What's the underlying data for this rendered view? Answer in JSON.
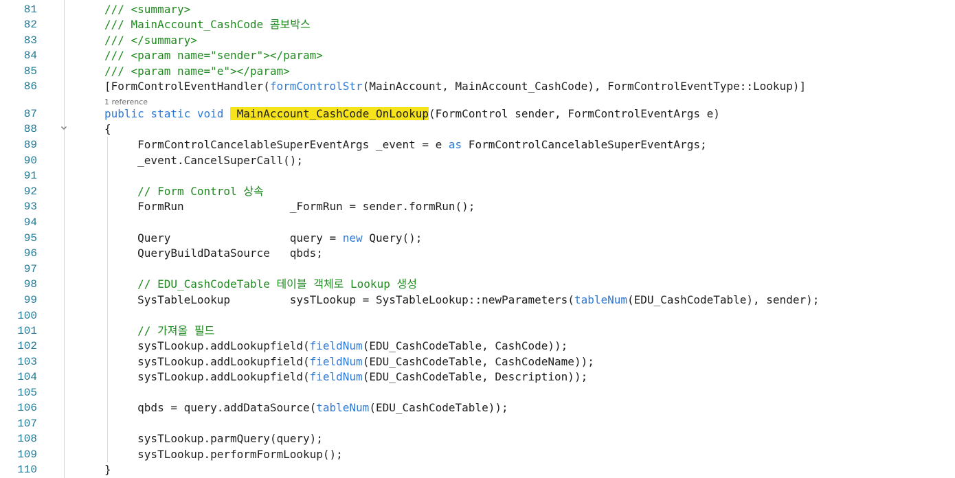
{
  "colors": {
    "comment": "#1f8a1f",
    "keyword": "#2f79d6",
    "text": "#1e1e1e",
    "line_number": "#237893",
    "highlight": "#f7e31b",
    "codelens": "#6a6a6a"
  },
  "codelens": {
    "label": "1 reference"
  },
  "fold_icon": "chevron-down-icon",
  "lines": [
    {
      "num": "81",
      "tokens": [
        {
          "t": "/// <summary>",
          "c": "comment"
        }
      ]
    },
    {
      "num": "82",
      "tokens": [
        {
          "t": "/// MainAccount_CashCode 콤보박스",
          "c": "comment"
        }
      ]
    },
    {
      "num": "83",
      "tokens": [
        {
          "t": "/// </summary>",
          "c": "comment"
        }
      ]
    },
    {
      "num": "84",
      "tokens": [
        {
          "t": "/// <param name=\"sender\"></param>",
          "c": "comment"
        }
      ]
    },
    {
      "num": "85",
      "tokens": [
        {
          "t": "/// <param name=\"e\"></param>",
          "c": "comment"
        }
      ]
    },
    {
      "num": "86",
      "tokens": [
        {
          "t": "[FormControlEventHandler(",
          "c": "text"
        },
        {
          "t": "formControlStr",
          "c": "keyword"
        },
        {
          "t": "(MainAccount, MainAccount_CashCode), FormControlEventType::Lookup)]",
          "c": "text"
        }
      ]
    },
    {
      "num": "87",
      "tokens": [
        {
          "t": "public static void",
          "c": "keyword"
        },
        {
          "t": " ",
          "c": "text"
        },
        {
          "t": " MainAccount_CashCode_OnLookup",
          "c": "highlight"
        },
        {
          "t": "(FormControl sender, FormControlEventArgs e)",
          "c": "text"
        }
      ]
    },
    {
      "num": "88",
      "fold": true,
      "tokens": [
        {
          "t": "{",
          "c": "text"
        }
      ]
    },
    {
      "num": "89",
      "tokens": [
        {
          "t": "     FormControlCancelableSuperEventArgs _event = e ",
          "c": "text"
        },
        {
          "t": "as",
          "c": "keyword"
        },
        {
          "t": " FormControlCancelableSuperEventArgs;",
          "c": "text"
        }
      ]
    },
    {
      "num": "90",
      "tokens": [
        {
          "t": "     _event.CancelSuperCall();",
          "c": "text"
        }
      ]
    },
    {
      "num": "91",
      "tokens": []
    },
    {
      "num": "92",
      "tokens": [
        {
          "t": "     // Form Control 상속",
          "c": "comment"
        }
      ]
    },
    {
      "num": "93",
      "tokens": [
        {
          "t": "     FormRun                _FormRun = sender.formRun();",
          "c": "text"
        }
      ]
    },
    {
      "num": "94",
      "tokens": []
    },
    {
      "num": "95",
      "tokens": [
        {
          "t": "     Query                  query = ",
          "c": "text"
        },
        {
          "t": "new",
          "c": "keyword"
        },
        {
          "t": " Query();",
          "c": "text"
        }
      ]
    },
    {
      "num": "96",
      "tokens": [
        {
          "t": "     QueryBuildDataSource   qbds;",
          "c": "text"
        }
      ]
    },
    {
      "num": "97",
      "tokens": []
    },
    {
      "num": "98",
      "tokens": [
        {
          "t": "     // EDU_CashCodeTable 테이블 객체로 Lookup 생성",
          "c": "comment"
        }
      ]
    },
    {
      "num": "99",
      "tokens": [
        {
          "t": "     SysTableLookup         sysTLookup = SysTableLookup::newParameters(",
          "c": "text"
        },
        {
          "t": "tableNum",
          "c": "keyword"
        },
        {
          "t": "(EDU_CashCodeTable), sender);",
          "c": "text"
        }
      ]
    },
    {
      "num": "100",
      "tokens": []
    },
    {
      "num": "101",
      "tokens": [
        {
          "t": "     // 가져올 필드",
          "c": "comment"
        }
      ]
    },
    {
      "num": "102",
      "tokens": [
        {
          "t": "     sysTLookup.addLookupfield(",
          "c": "text"
        },
        {
          "t": "fieldNum",
          "c": "keyword"
        },
        {
          "t": "(EDU_CashCodeTable, CashCode));",
          "c": "text"
        }
      ]
    },
    {
      "num": "103",
      "tokens": [
        {
          "t": "     sysTLookup.addLookupfield(",
          "c": "text"
        },
        {
          "t": "fieldNum",
          "c": "keyword"
        },
        {
          "t": "(EDU_CashCodeTable, CashCodeName));",
          "c": "text"
        }
      ]
    },
    {
      "num": "104",
      "tokens": [
        {
          "t": "     sysTLookup.addLookupfield(",
          "c": "text"
        },
        {
          "t": "fieldNum",
          "c": "keyword"
        },
        {
          "t": "(EDU_CashCodeTable, Description));",
          "c": "text"
        }
      ]
    },
    {
      "num": "105",
      "tokens": []
    },
    {
      "num": "106",
      "tokens": [
        {
          "t": "     qbds = query.addDataSource(",
          "c": "text"
        },
        {
          "t": "tableNum",
          "c": "keyword"
        },
        {
          "t": "(EDU_CashCodeTable));",
          "c": "text"
        }
      ]
    },
    {
      "num": "107",
      "tokens": []
    },
    {
      "num": "108",
      "tokens": [
        {
          "t": "     sysTLookup.parmQuery(query);",
          "c": "text"
        }
      ]
    },
    {
      "num": "109",
      "tokens": [
        {
          "t": "     sysTLookup.performFormLookup();",
          "c": "text"
        }
      ]
    },
    {
      "num": "110",
      "tokens": [
        {
          "t": "}",
          "c": "text"
        }
      ]
    }
  ]
}
